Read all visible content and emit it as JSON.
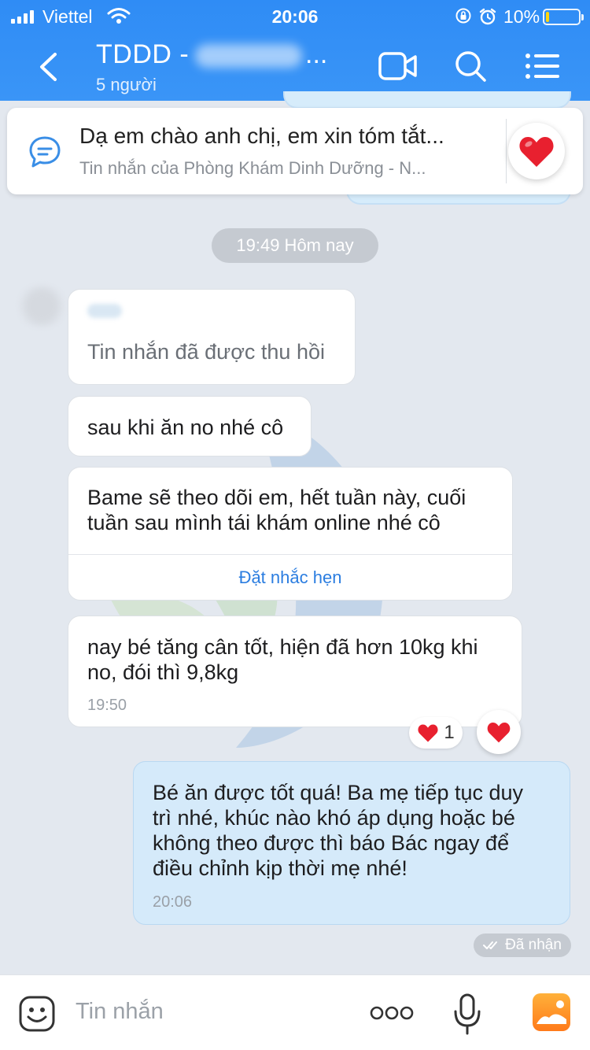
{
  "status_bar": {
    "carrier": "Viettel",
    "time": "20:06",
    "battery_percent": "10%",
    "battery_level": 0.1
  },
  "nav": {
    "title": "TDDD -",
    "title_ellipsis": "...",
    "subtitle": "5 người"
  },
  "pinned": {
    "text": "Dạ em chào anh chị, em xin tóm tắt...",
    "sub": "Tin nhắn của Phòng Khám Dinh Dưỡng - N..."
  },
  "messages": {
    "time_divider": "19:49 Hôm nay",
    "recalled": "Tin nhắn đã được thu hồi",
    "msg1": "sau khi ăn no nhé cô",
    "msg2_line1": "Bame sẽ theo dõi em, hết tuần này, cuối",
    "msg2_line2": "tuần sau mình tái khám online nhé cô",
    "remind_link": "Đặt nhắc hẹn",
    "msg3_line1": "nay bé tăng cân tốt, hiện đã hơn 10kg khi",
    "msg3_line2": "no, đói thì 9,8kg",
    "msg3_time": "19:50",
    "reaction_count": "1",
    "sent_line1": "Bé ăn được tốt quá! Ba mẹ tiếp tục duy",
    "sent_line2": "trì nhé, khúc nào khó áp dụng hoặc bé",
    "sent_line3": "không theo được thì báo Bác ngay để",
    "sent_line4": "điều chỉnh kịp thời mẹ nhé!",
    "sent_time": "20:06",
    "delivery_status": "Đã nhận"
  },
  "input": {
    "placeholder": "Tin nhắn"
  },
  "icons": {
    "back": "chevron-left-icon",
    "video": "video-call-icon",
    "search": "search-icon",
    "menu": "list-menu-icon",
    "pinned": "chat-bubble-icon",
    "heart": "heart-icon",
    "emoji": "emoji-icon",
    "more": "more-dots-icon",
    "mic": "microphone-icon",
    "image": "image-icon"
  },
  "colors": {
    "header": "#2f8cf5",
    "sent_bubble": "#d5eafa",
    "heart": "#e8202f",
    "link": "#2b7de0"
  }
}
